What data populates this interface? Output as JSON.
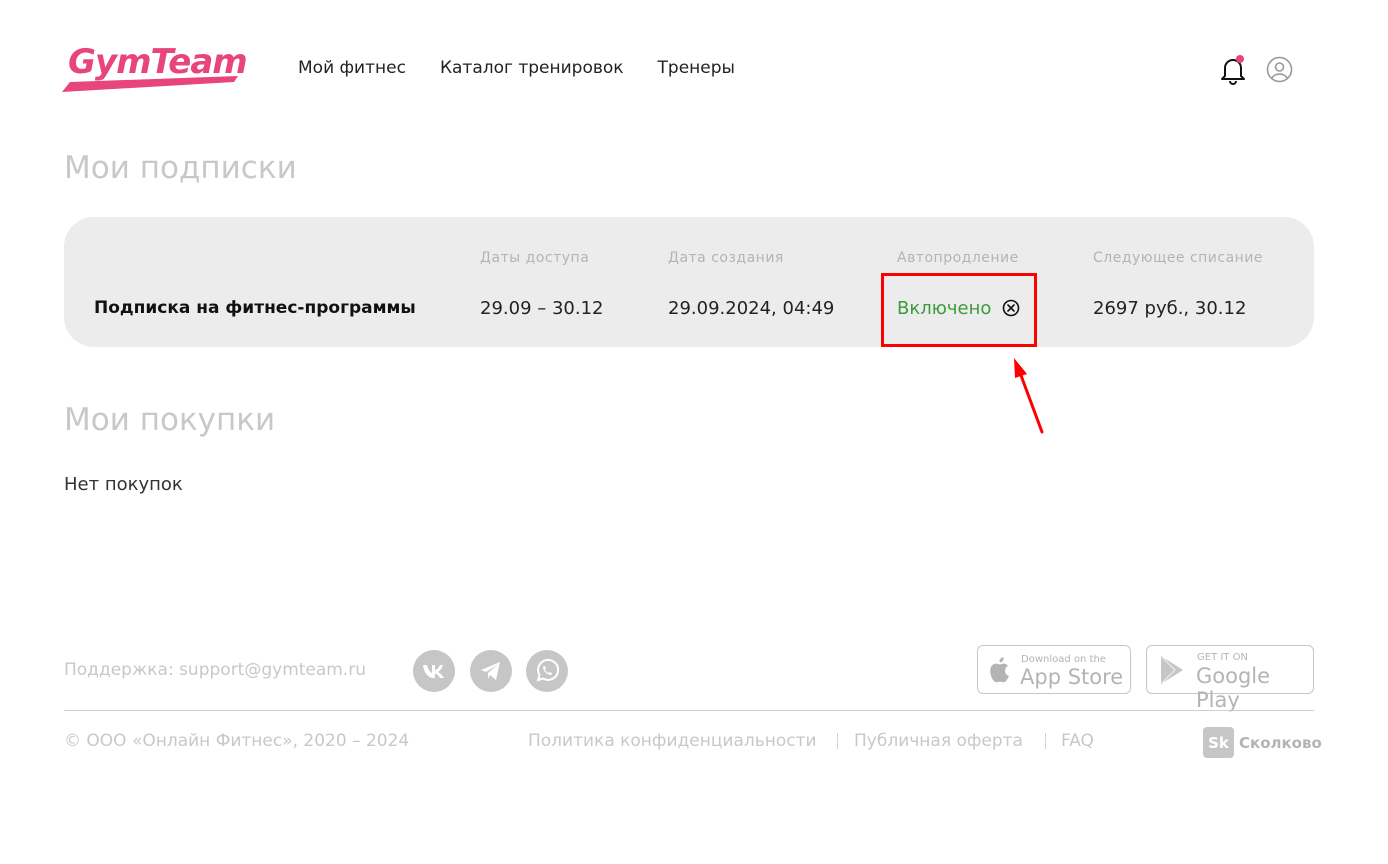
{
  "header": {
    "logo": "GymTeam",
    "nav": [
      "Мой фитнес",
      "Каталог тренировок",
      "Тренеры"
    ]
  },
  "subscriptions": {
    "title": "Мои подписки",
    "columns": {
      "access": "Даты доступа",
      "created": "Дата создания",
      "autorenew": "Автопродление",
      "next": "Следующее списание"
    },
    "row": {
      "name": "Подписка на фитнес-программы",
      "access": "29.09 – 30.12",
      "created": "29.09.2024, 04:49",
      "autorenew": "Включено",
      "next": "2697 руб., 30.12"
    }
  },
  "purchases": {
    "title": "Мои покупки",
    "empty": "Нет покупок"
  },
  "footer": {
    "support": "Поддержка: support@gymteam.ru",
    "app_store": {
      "small": "Download on the",
      "big": "App Store"
    },
    "google_play": {
      "small": "GET IT ON",
      "big": "Google Play"
    },
    "copyright": "© ООО «Онлайн Фитнес», 2020 – 2024",
    "links": [
      "Политика конфиденциальности",
      "Публичная оферта",
      "FAQ"
    ],
    "skolkovo": {
      "badge": "Sk",
      "label": "Сколково"
    }
  },
  "colors": {
    "brand": "#e8457a",
    "enabled": "#3d9a3d",
    "highlight": "#ff0000"
  }
}
